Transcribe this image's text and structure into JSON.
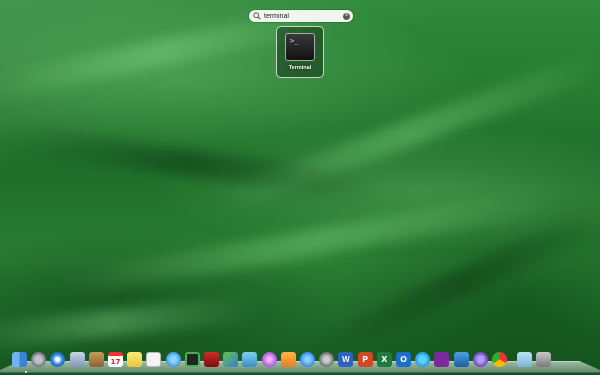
{
  "spotlight": {
    "query": "terminal"
  },
  "results": [
    {
      "label": "Terminal",
      "icon": "terminal-icon",
      "prompt": ">_"
    }
  ],
  "dock": {
    "items": [
      {
        "name": "finder-icon",
        "glyph": ""
      },
      {
        "name": "launchpad-icon",
        "glyph": ""
      },
      {
        "name": "safari-icon",
        "glyph": ""
      },
      {
        "name": "mail-icon",
        "glyph": ""
      },
      {
        "name": "contacts-icon",
        "glyph": ""
      },
      {
        "name": "calendar-icon",
        "glyph": "17"
      },
      {
        "name": "notes-icon",
        "glyph": ""
      },
      {
        "name": "reminders-icon",
        "glyph": ""
      },
      {
        "name": "messages-icon",
        "glyph": ""
      },
      {
        "name": "facetime-icon",
        "glyph": ""
      },
      {
        "name": "photo-booth-icon",
        "glyph": ""
      },
      {
        "name": "photos-icon",
        "glyph": ""
      },
      {
        "name": "preview-icon",
        "glyph": ""
      },
      {
        "name": "itunes-icon",
        "glyph": ""
      },
      {
        "name": "ibooks-icon",
        "glyph": ""
      },
      {
        "name": "app-store-icon",
        "glyph": ""
      },
      {
        "name": "system-preferences-icon",
        "glyph": ""
      },
      {
        "name": "word-icon",
        "glyph": "W"
      },
      {
        "name": "powerpoint-icon",
        "glyph": "P"
      },
      {
        "name": "excel-icon",
        "glyph": "X"
      },
      {
        "name": "outlook-icon",
        "glyph": "O"
      },
      {
        "name": "skype-icon",
        "glyph": ""
      },
      {
        "name": "onenote-icon",
        "glyph": ""
      },
      {
        "name": "utility-icon",
        "glyph": ""
      },
      {
        "name": "browser-icon",
        "glyph": ""
      },
      {
        "name": "chrome-icon",
        "glyph": ""
      },
      {
        "name": "downloads-folder-icon",
        "glyph": ""
      },
      {
        "name": "trash-icon",
        "glyph": ""
      }
    ]
  }
}
